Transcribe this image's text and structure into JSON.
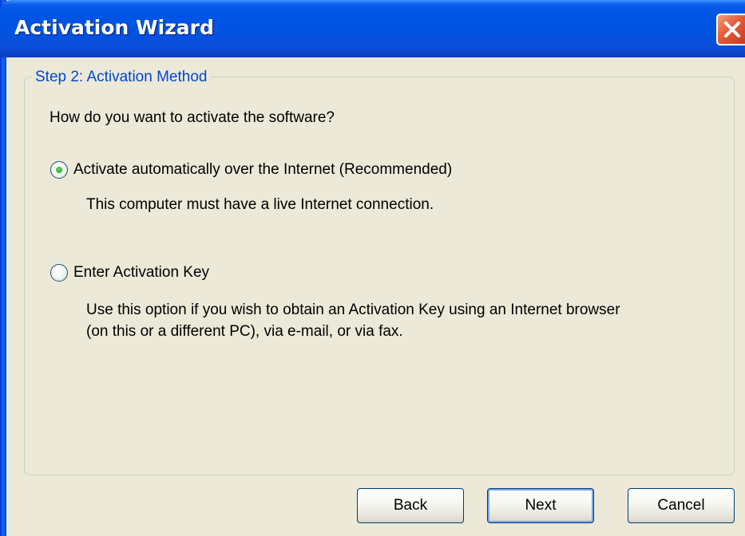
{
  "window": {
    "title": "Activation Wizard",
    "close_icon": "close-icon"
  },
  "step": {
    "legend": "Step 2: Activation Method",
    "question": "How do you want to activate the software?"
  },
  "options": [
    {
      "label": "Activate automatically over the Internet (Recommended)",
      "description": "This computer must have a live Internet connection.",
      "selected": true
    },
    {
      "label": "Enter Activation Key",
      "description_lines": [
        "Use this option if you wish to obtain an Activation Key using an Internet browser",
        "(on this or a different PC), via e-mail, or via fax."
      ],
      "selected": false
    }
  ],
  "buttons": {
    "back": "Back",
    "next": "Next",
    "cancel": "Cancel"
  },
  "colors": {
    "titlebar": "#0055e5",
    "dialog_bg": "#ece9d8",
    "legend_text": "#0046d5",
    "close_button": "#e35a36",
    "radio_dot": "#21a121"
  }
}
